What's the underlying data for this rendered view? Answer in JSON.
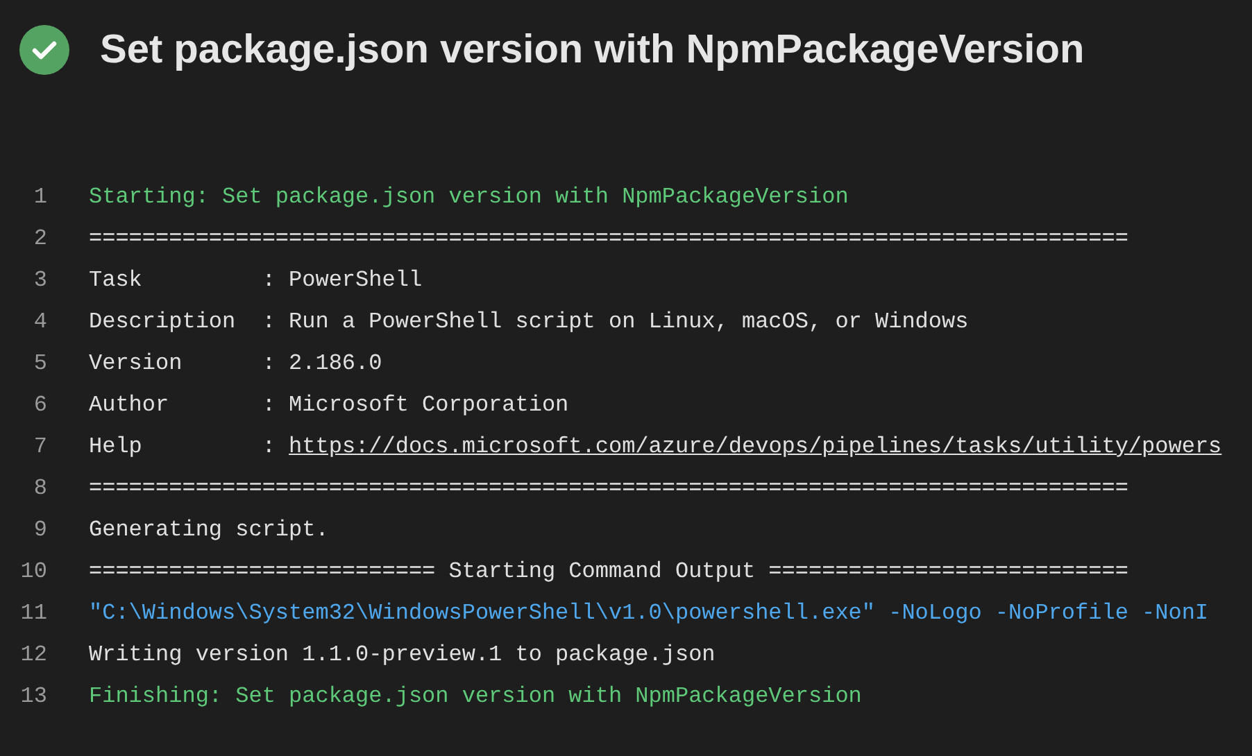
{
  "header": {
    "succeeded": true,
    "title": "Set package.json version with NpmPackageVersion"
  },
  "log": {
    "lines": [
      {
        "number": "1",
        "segments": [
          {
            "kind": "section",
            "text": "Starting: Set package.json version with NpmPackageVersion"
          }
        ]
      },
      {
        "number": "2",
        "segments": [
          {
            "kind": "plain",
            "text": "=============================================================================="
          }
        ]
      },
      {
        "number": "3",
        "segments": [
          {
            "kind": "plain",
            "text": "Task         : PowerShell"
          }
        ]
      },
      {
        "number": "4",
        "segments": [
          {
            "kind": "plain",
            "text": "Description  : Run a PowerShell script on Linux, macOS, or Windows"
          }
        ]
      },
      {
        "number": "5",
        "segments": [
          {
            "kind": "plain",
            "text": "Version      : 2.186.0"
          }
        ]
      },
      {
        "number": "6",
        "segments": [
          {
            "kind": "plain",
            "text": "Author       : Microsoft Corporation"
          }
        ]
      },
      {
        "number": "7",
        "segments": [
          {
            "kind": "plain",
            "text": "Help         : "
          },
          {
            "kind": "link",
            "text": "https://docs.microsoft.com/azure/devops/pipelines/tasks/utility/powers"
          }
        ]
      },
      {
        "number": "8",
        "segments": [
          {
            "kind": "plain",
            "text": "=============================================================================="
          }
        ]
      },
      {
        "number": "9",
        "segments": [
          {
            "kind": "plain",
            "text": "Generating script."
          }
        ]
      },
      {
        "number": "10",
        "segments": [
          {
            "kind": "plain",
            "text": "========================== Starting Command Output ==========================="
          }
        ]
      },
      {
        "number": "11",
        "segments": [
          {
            "kind": "command",
            "text": "\"C:\\Windows\\System32\\WindowsPowerShell\\v1.0\\powershell.exe\" -NoLogo -NoProfile -NonI"
          }
        ]
      },
      {
        "number": "12",
        "segments": [
          {
            "kind": "plain",
            "text": "Writing version 1.1.0-preview.1 to package.json"
          }
        ]
      },
      {
        "number": "13",
        "segments": [
          {
            "kind": "section",
            "text": "Finishing: Set package.json version with NpmPackageVersion"
          }
        ]
      }
    ]
  }
}
